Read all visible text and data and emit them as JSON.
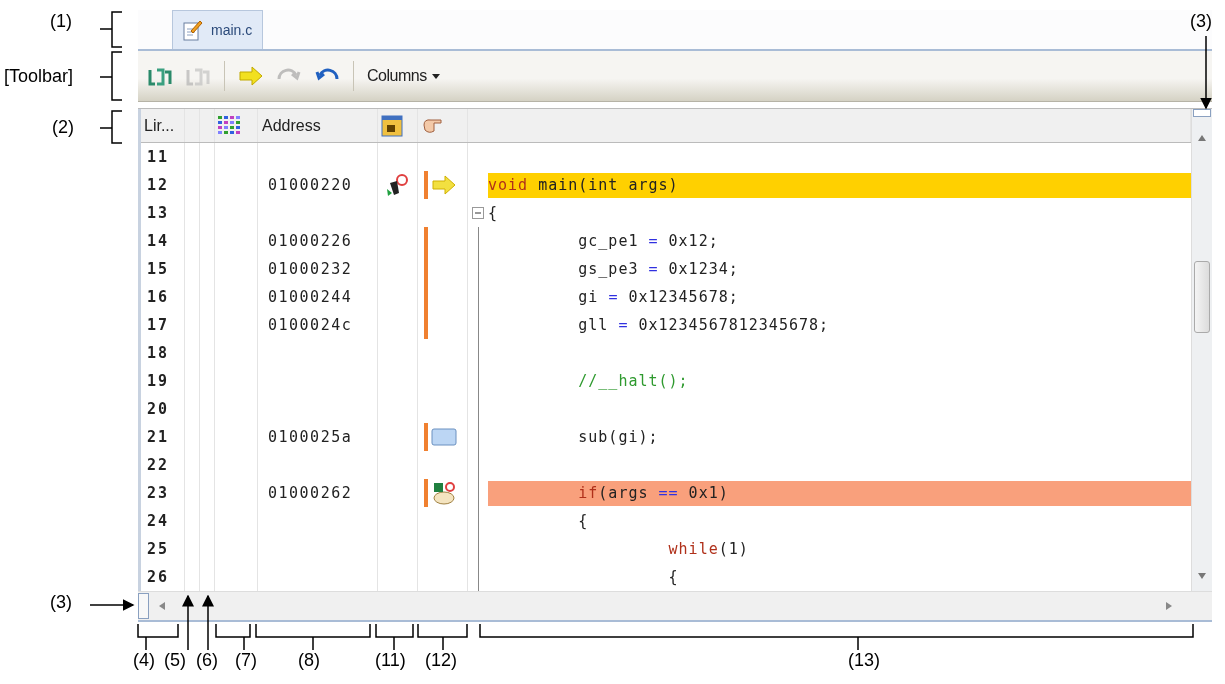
{
  "tab": {
    "label": "main.c",
    "selected": true
  },
  "toolbar": [
    {
      "kind": "jump",
      "disabled": false
    },
    {
      "kind": "jump",
      "disabled": true
    },
    {
      "kind": "separator"
    },
    {
      "kind": "arrow",
      "disabled": false
    },
    {
      "kind": "redo",
      "disabled": true
    },
    {
      "kind": "undo",
      "disabled": false
    },
    {
      "kind": "separator"
    },
    {
      "kind": "menu",
      "label": "Columns",
      "disabled": false
    }
  ],
  "header": {
    "line": "Lir...",
    "address": "Address"
  },
  "rows": [
    {
      "line": "11",
      "address": "",
      "event": false,
      "coverage": false,
      "fold": false,
      "current": false,
      "breakpoint": false,
      "code": []
    },
    {
      "line": "12",
      "address": "01000220",
      "event": true,
      "coverage": true,
      "marker": {
        "kind": "pc"
      },
      "fold": false,
      "current": true,
      "breakpoint": false,
      "code": [
        {
          "kind": "keyword",
          "text": "void"
        },
        {
          "kind": "plain",
          "text": " main(int args)"
        }
      ]
    },
    {
      "line": "13",
      "address": "",
      "event": false,
      "coverage": false,
      "fold": true,
      "current": false,
      "breakpoint": false,
      "code": [
        {
          "kind": "plain",
          "text": "{"
        }
      ]
    },
    {
      "line": "14",
      "address": "01000226",
      "event": false,
      "coverage": true,
      "fold": false,
      "current": false,
      "breakpoint": false,
      "code": [
        {
          "kind": "plain",
          "text": "\tgc_pe1 "
        },
        {
          "kind": "operator",
          "text": "="
        },
        {
          "kind": "plain",
          "text": " 0x12;"
        }
      ]
    },
    {
      "line": "15",
      "address": "01000232",
      "event": false,
      "coverage": true,
      "fold": false,
      "current": false,
      "breakpoint": false,
      "code": [
        {
          "kind": "plain",
          "text": "\tgs_pe3 "
        },
        {
          "kind": "operator",
          "text": "="
        },
        {
          "kind": "plain",
          "text": " 0x1234;"
        }
      ]
    },
    {
      "line": "16",
      "address": "01000244",
      "event": false,
      "coverage": true,
      "fold": false,
      "current": false,
      "breakpoint": false,
      "code": [
        {
          "kind": "plain",
          "text": "\tgi "
        },
        {
          "kind": "operator",
          "text": "="
        },
        {
          "kind": "plain",
          "text": " 0x12345678;"
        }
      ]
    },
    {
      "line": "17",
      "address": "0100024c",
      "event": false,
      "coverage": true,
      "fold": false,
      "current": false,
      "breakpoint": false,
      "code": [
        {
          "kind": "plain",
          "text": "\tgll "
        },
        {
          "kind": "operator",
          "text": "="
        },
        {
          "kind": "plain",
          "text": " 0x1234567812345678;"
        }
      ]
    },
    {
      "line": "18",
      "address": "",
      "event": false,
      "coverage": false,
      "fold": false,
      "current": false,
      "breakpoint": false,
      "code": []
    },
    {
      "line": "19",
      "address": "",
      "event": false,
      "coverage": false,
      "fold": false,
      "current": false,
      "breakpoint": false,
      "code": [
        {
          "kind": "comment",
          "text": "\t//__halt();"
        }
      ]
    },
    {
      "line": "20",
      "address": "",
      "event": false,
      "coverage": false,
      "fold": false,
      "current": false,
      "breakpoint": false,
      "code": []
    },
    {
      "line": "21",
      "address": "0100025a",
      "event": false,
      "coverage": true,
      "marker": {
        "kind": "bookmark"
      },
      "fold": false,
      "current": false,
      "breakpoint": false,
      "code": [
        {
          "kind": "plain",
          "text": "\tsub(gi);"
        }
      ]
    },
    {
      "line": "22",
      "address": "",
      "event": false,
      "coverage": false,
      "fold": false,
      "current": false,
      "breakpoint": false,
      "code": []
    },
    {
      "line": "23",
      "address": "01000262",
      "event": false,
      "coverage": true,
      "marker": {
        "kind": "combo"
      },
      "fold": false,
      "current": false,
      "breakpoint": true,
      "code": [
        {
          "kind": "keyword",
          "text": "\tif"
        },
        {
          "kind": "plain",
          "text": "(args "
        },
        {
          "kind": "operator",
          "text": "=="
        },
        {
          "kind": "plain",
          "text": " 0x1)"
        }
      ]
    },
    {
      "line": "24",
      "address": "",
      "event": false,
      "coverage": false,
      "fold": false,
      "current": false,
      "breakpoint": false,
      "code": [
        {
          "kind": "plain",
          "text": "\t{"
        }
      ]
    },
    {
      "line": "25",
      "address": "",
      "event": false,
      "coverage": false,
      "fold": false,
      "current": false,
      "breakpoint": false,
      "code": [
        {
          "kind": "keyword",
          "text": "\t\twhile"
        },
        {
          "kind": "plain",
          "text": "(1)"
        }
      ]
    },
    {
      "line": "26",
      "address": "",
      "event": false,
      "coverage": false,
      "fold": false,
      "current": false,
      "breakpoint": false,
      "code": [
        {
          "kind": "plain",
          "text": "\t\t{"
        }
      ]
    }
  ],
  "callouts": {
    "left": [
      "(1)",
      "[Toolbar]",
      "(2)",
      "(3)"
    ],
    "top_right": "(3)",
    "bottom": [
      "(4)",
      "(5)",
      "(6)",
      "(7)",
      "(8)",
      "(11)",
      "(12)",
      "(13)"
    ]
  }
}
